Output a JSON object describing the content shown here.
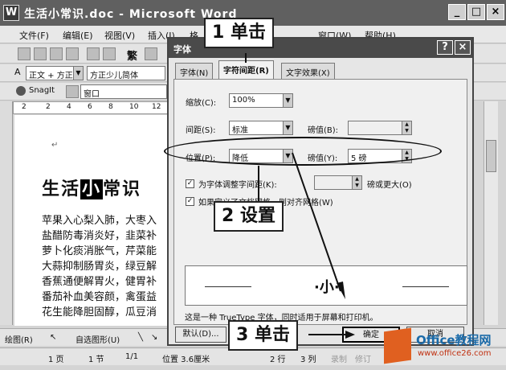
{
  "window": {
    "title": "生活小常识.doc - Microsoft Word",
    "app_icon": "W",
    "controls": [
      "_",
      "□",
      "×"
    ]
  },
  "menu": [
    "文件(F)",
    "编辑(E)",
    "视图(V)",
    "插入(I)",
    "格",
    "窗口(W)",
    "帮助(H)"
  ],
  "toolbar": {
    "style_combo": "正文 + 方正",
    "font_combo": "方正少儿简体",
    "snagit_label": "SnagIt",
    "window_label": "窗口",
    "convert_label": "繁"
  },
  "ruler_marks": [
    "2",
    "2",
    "4",
    "6",
    "8",
    "10",
    "12"
  ],
  "document": {
    "heading_pre": "生活",
    "heading_sel": "小",
    "heading_post": "常识",
    "lines": [
      "苹果入心梨入肺，大枣入",
      "盐醋防毒消炎好，韭菜补",
      "萝卜化痰消胀气，芹菜能",
      "大蒜抑制肠胃炎，绿豆解",
      "香蕉通便解胃火，健胃补",
      "番茄补血美容颜，禽蛋益",
      "花生能降胆固醇，瓜豆消"
    ]
  },
  "dialog": {
    "title": "字体",
    "help_btn": "?",
    "close_btn": "×",
    "tabs": [
      "字体(N)",
      "字符间距(R)",
      "文字效果(X)"
    ],
    "scale_label": "缩放(C):",
    "scale_value": "100%",
    "spacing_label": "间距(S):",
    "spacing_value": "标准",
    "spacing_by_label": "磅值(B):",
    "spacing_by_value": "",
    "position_label": "位置(P):",
    "position_value": "降低",
    "position_by_label": "磅值(Y):",
    "position_by_value": "5 磅",
    "kerning_label": "为字体调整字间距(K):",
    "kerning_value": "",
    "kerning_suffix": "磅或更大(O)",
    "grid_label": "如果定义了文档网格，则对齐网格(W)",
    "preview_label": "预览",
    "preview_text": "·小·",
    "truetype_note": "这是一种 TrueType 字体，同时适用于屏幕和打印机。",
    "default_btn": "默认(D)...",
    "ok_btn": "确定",
    "cancel_btn": "取消"
  },
  "callouts": {
    "step1": "1 单击",
    "step2": "2 设置",
    "step3": "3 单击"
  },
  "drawbar": {
    "draw_label": "绘图(R)",
    "autoshape_label": "自选图形(U)"
  },
  "status": {
    "page": "1 页",
    "section": "1 节",
    "pages": "1/1",
    "position": "位置 3.6厘米",
    "line": "2 行",
    "column": "3 列",
    "rec": "录制",
    "trk": "修订"
  },
  "watermark": {
    "name": "Office教程网",
    "url": "www.office26.com"
  }
}
